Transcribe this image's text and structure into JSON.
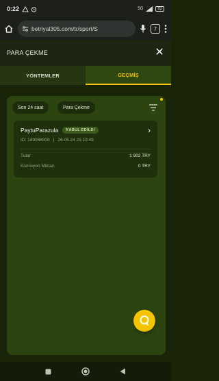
{
  "status_bar": {
    "time": "0:22",
    "network": "5G",
    "battery": "82"
  },
  "browser": {
    "url": "betriyal305.com/tr/sport/S",
    "tab_count": "7"
  },
  "header": {
    "title": "PARA ÇEKME"
  },
  "tabs": [
    {
      "label": "YÖNTEMLER",
      "active": false
    },
    {
      "label": "GEÇMİŞ",
      "active": true
    }
  ],
  "filters": {
    "period": "Son 24 saat",
    "type": "Para Çekme"
  },
  "transaction": {
    "method": "PaytuParazula",
    "status": "KABUL EDİLDİ",
    "id": "ID: 149068908",
    "separator": "|",
    "datetime": "26.05.24 21:10:49",
    "amount_label": "Tutar",
    "amount_value": "1 902 TRY",
    "fee_label": "Komisyon Miktarı",
    "fee_value": "0 TRY"
  },
  "colors": {
    "accent": "#f3c300",
    "panel": "#2c4510",
    "card": "#1f300c"
  },
  "icons": {
    "header": "close-icon",
    "card": "chevron-right-icon",
    "filter": "filter-icon",
    "fab": "chat-icon"
  }
}
